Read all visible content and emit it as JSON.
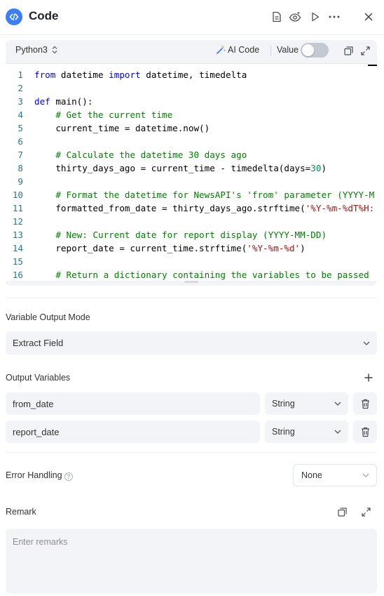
{
  "header": {
    "title": "Code",
    "icons": [
      "file-icon",
      "eye-sparkle-icon",
      "play-icon",
      "more-icon",
      "close-icon"
    ]
  },
  "code_panel": {
    "language": "Python3",
    "ai_code_label": "AI Code",
    "value_label": "Value",
    "value_toggle_on": false,
    "lines": [
      {
        "n": "1",
        "text": "from datetime import datetime, timedelta"
      },
      {
        "n": "2",
        "text": ""
      },
      {
        "n": "3",
        "text": "def main():"
      },
      {
        "n": "4",
        "text": "    # Get the current time"
      },
      {
        "n": "5",
        "text": "    current_time = datetime.now()"
      },
      {
        "n": "6",
        "text": ""
      },
      {
        "n": "7",
        "text": "    # Calculate the datetime 30 days ago"
      },
      {
        "n": "8",
        "text": "    thirty_days_ago = current_time - timedelta(days=30)"
      },
      {
        "n": "9",
        "text": ""
      },
      {
        "n": "10",
        "text": "    # Format the datetime for NewsAPI's 'from' parameter (YYYY-M"
      },
      {
        "n": "11",
        "text": "    formatted_from_date = thirty_days_ago.strftime('%Y-%m-%dT%H:"
      },
      {
        "n": "12",
        "text": ""
      },
      {
        "n": "13",
        "text": "    # New: Current date for report display (YYYY-MM-DD)"
      },
      {
        "n": "14",
        "text": "    report_date = current_time.strftime('%Y-%m-%d')"
      },
      {
        "n": "15",
        "text": ""
      },
      {
        "n": "16",
        "text": "    # Return a dictionary containing the variables to be passed"
      }
    ]
  },
  "variable_output_mode": {
    "label": "Variable Output Mode",
    "value": "Extract Field"
  },
  "output_variables": {
    "label": "Output Variables",
    "items": [
      {
        "name": "from_date",
        "type": "String"
      },
      {
        "name": "report_date",
        "type": "String"
      }
    ]
  },
  "error_handling": {
    "label": "Error Handling",
    "help": "?",
    "value": "None"
  },
  "remark": {
    "label": "Remark",
    "placeholder": "Enter remarks"
  },
  "colors": {
    "accent": "#3b7ff6",
    "panel_bg": "#f2f4f7",
    "keyword": "#0000ff",
    "comment": "#008000",
    "string": "#a31515",
    "number": "#098658",
    "line_number": "#237893"
  }
}
